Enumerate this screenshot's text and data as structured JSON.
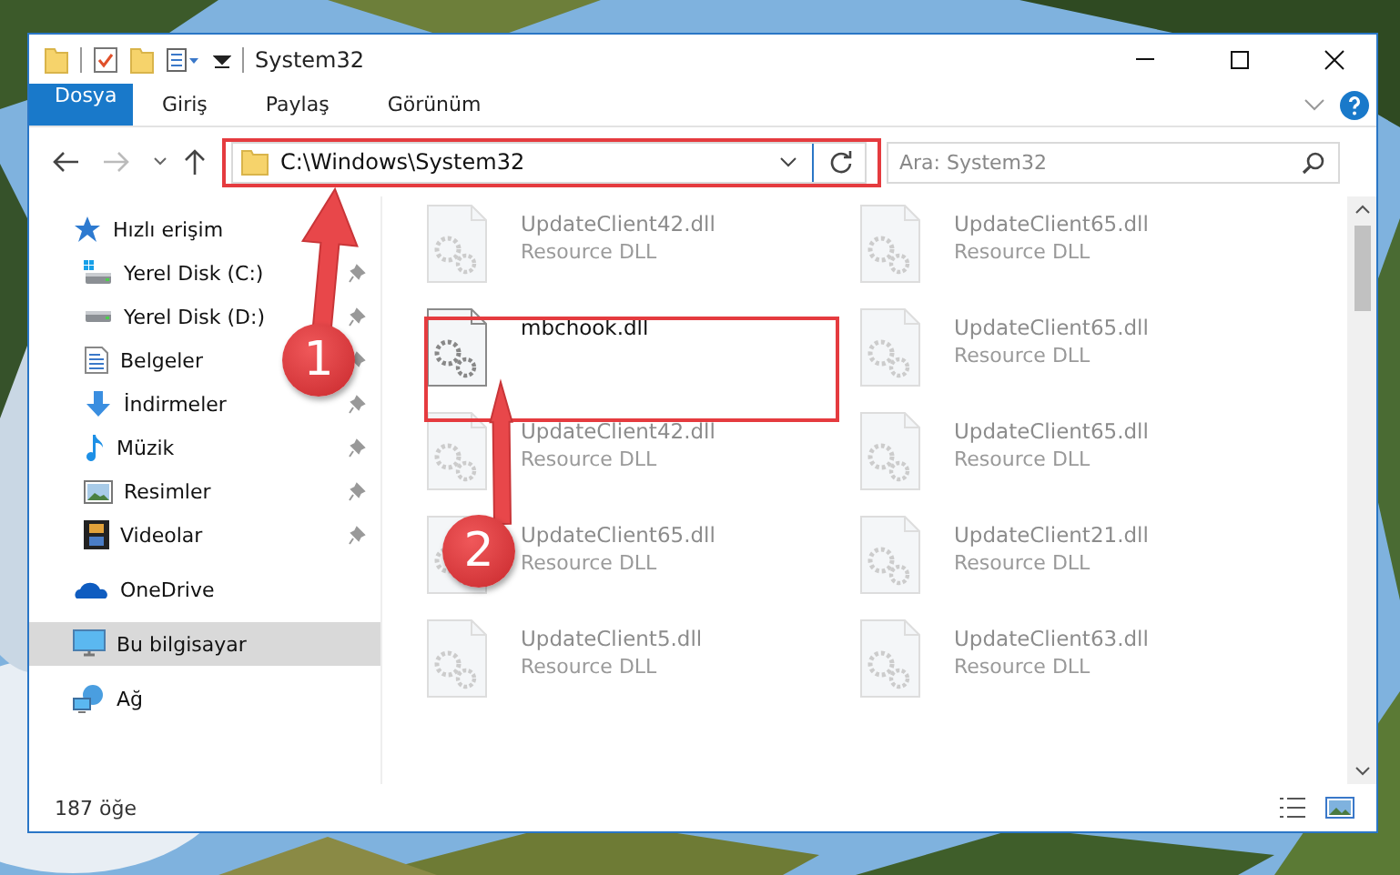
{
  "window": {
    "title": "System32"
  },
  "ribbon": {
    "tabs": [
      {
        "label": "Dosya",
        "kind": "file"
      },
      {
        "label": "Giriş",
        "kind": "tab"
      },
      {
        "label": "Paylaş",
        "kind": "tab"
      },
      {
        "label": "Görünüm",
        "kind": "tab"
      }
    ]
  },
  "address_bar": {
    "path": "C:\\Windows\\System32"
  },
  "search": {
    "placeholder": "Ara: System32"
  },
  "nav_pane": {
    "items": [
      {
        "label": "Hızlı erişim",
        "kind": "star",
        "selected": false,
        "children": [
          {
            "label": "Yerel Disk (C:)",
            "kind": "drive-system",
            "pinned": true
          },
          {
            "label": "Yerel Disk (D:)",
            "kind": "drive",
            "pinned": true
          },
          {
            "label": "Belgeler",
            "kind": "documents",
            "pinned": true
          },
          {
            "label": "İndirmeler",
            "kind": "downloads",
            "pinned": true
          },
          {
            "label": "Müzik",
            "kind": "music",
            "pinned": true
          },
          {
            "label": "Resimler",
            "kind": "pictures",
            "pinned": true
          },
          {
            "label": "Videolar",
            "kind": "videos",
            "pinned": true
          }
        ]
      },
      {
        "label": "OneDrive",
        "kind": "cloud",
        "selected": false
      },
      {
        "label": "Bu bilgisayar",
        "kind": "computer",
        "selected": true
      },
      {
        "label": "Ağ",
        "kind": "network",
        "selected": false
      }
    ]
  },
  "files": [
    {
      "name": "UpdateClient42.dll",
      "type": "Resource DLL",
      "blurred": true
    },
    {
      "name": "UpdateClient65.dll",
      "type": "Resource DLL",
      "blurred": true
    },
    {
      "name": "mbchook.dll",
      "blurred": false
    },
    {
      "name": "UpdateClient65.dll",
      "type": "Resource DLL",
      "blurred": true
    },
    {
      "name": "UpdateClient42.dll",
      "type": "Resource DLL",
      "blurred": true
    },
    {
      "name": "UpdateClient65.dll",
      "type": "Resource DLL",
      "blurred": true
    },
    {
      "name": "UpdateClient65.dll",
      "type": "Resource DLL",
      "blurred": true
    },
    {
      "name": "UpdateClient21.dll",
      "type": "Resource DLL",
      "blurred": true
    },
    {
      "name": "UpdateClient5.dll",
      "type": "Resource DLL",
      "blurred": true
    },
    {
      "name": "UpdateClient63.dll",
      "type": "Resource DLL",
      "blurred": true
    }
  ],
  "status_bar": {
    "count": "187 öğe"
  },
  "annotations": [
    {
      "number": "1"
    },
    {
      "number": "2"
    }
  ]
}
